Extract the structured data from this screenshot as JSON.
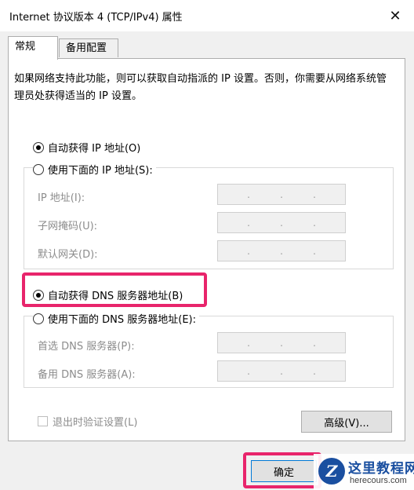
{
  "window": {
    "title": "Internet 协议版本 4 (TCP/IPv4) 属性",
    "close_glyph": "✕"
  },
  "tabs": [
    {
      "label": "常规",
      "active": true
    },
    {
      "label": "备用配置",
      "active": false
    }
  ],
  "description": "如果网络支持此功能，则可以获取自动指派的 IP 设置。否则，你需要从网络系统管理员处获得适当的 IP 设置。",
  "ip_section": {
    "auto_label": "自动获得 IP 地址(O)",
    "auto_checked": true,
    "manual_label": "使用下面的 IP 地址(S):",
    "manual_checked": false,
    "fields": [
      {
        "label": "IP 地址(I):"
      },
      {
        "label": "子网掩码(U):"
      },
      {
        "label": "默认网关(D):"
      }
    ]
  },
  "dns_section": {
    "auto_label": "自动获得 DNS 服务器地址(B)",
    "auto_checked": true,
    "manual_label": "使用下面的 DNS 服务器地址(E):",
    "manual_checked": false,
    "fields": [
      {
        "label": "首选 DNS 服务器(P):"
      },
      {
        "label": "备用 DNS 服务器(A):"
      }
    ]
  },
  "validate_on_exit": {
    "label": "退出时验证设置(L)",
    "checked": false
  },
  "buttons": {
    "advanced": "高级(V)...",
    "ok": "确定"
  },
  "watermark": {
    "logo_letter": "Z",
    "title": "这里教程网",
    "url": "herecours.com"
  },
  "colors": {
    "highlight": "#e8246b",
    "watermark_blue": "#1a4fa0"
  }
}
